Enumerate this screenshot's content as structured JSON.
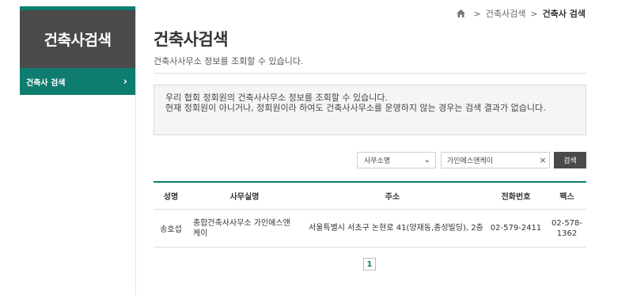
{
  "sidebar": {
    "title": "건축사검색",
    "items": [
      {
        "label": "건축사 검색",
        "active": true
      }
    ]
  },
  "breadcrumb": {
    "home_icon": "home-icon",
    "items": [
      "건축사검색",
      "건축사 검색"
    ],
    "separator": ">"
  },
  "page": {
    "title": "건축사검색",
    "subtitle": "건축사사무소 정보를 조회할 수 있습니다."
  },
  "notice": {
    "line1": "우리 협회 정회원의 건축사사무소 정보를 조회할 수 있습니다.",
    "line2": "현재 정회원이 아니거나, 정회원이라 하여도 건축사사무소를 운영하지 않는 경우는 검색 결과가 없습니다."
  },
  "search": {
    "select_value": "사무소명",
    "input_value": "가인에스앤케이",
    "clear_label": "×",
    "button_label": "검색"
  },
  "table": {
    "headers": [
      "성명",
      "사무실명",
      "주소",
      "전화번호",
      "팩스"
    ],
    "rows": [
      [
        "송호섭",
        "종합건축사사무소 가인에스앤케이",
        "서울특별시 서초구 논현로 41(양재동,종성빌딩), 2층",
        "02-579-2411",
        "02-578-1362"
      ]
    ]
  },
  "pagination": {
    "current_page": "1"
  },
  "colors": {
    "accent": "#0e7d6f",
    "sidebar_header": "#4a4a4a",
    "notice_bg": "#f5f5f5"
  }
}
